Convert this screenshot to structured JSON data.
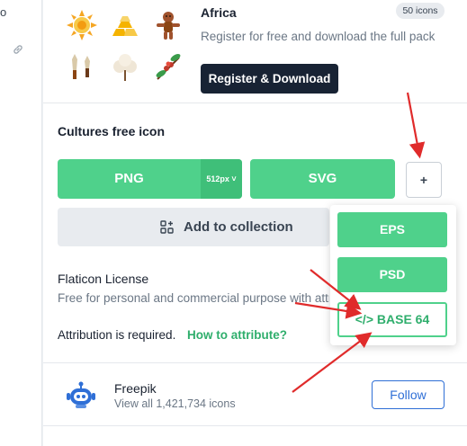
{
  "left_strip": {
    "text": "o",
    "icon": "link-icon"
  },
  "pack": {
    "title": "Africa",
    "count": "50 icons",
    "description": "Register for free and download the full pack",
    "register_label": "Register & Download",
    "icons": [
      "sun-icon",
      "gold-bars-icon",
      "voodoo-doll-icon",
      "knives-icon",
      "cotton-icon",
      "coffee-branch-icon"
    ]
  },
  "icon_title": "Cultures free icon",
  "download": {
    "png_label": "PNG",
    "png_size": "512px ˅",
    "svg_label": "SVG",
    "more_label": "+"
  },
  "collection": {
    "label": "Add to collection",
    "icon": "add-collection-icon"
  },
  "license": {
    "title": "Flaticon License",
    "description": "Free for personal and commercial purpose with attribution.",
    "attribution": "Attribution is required.",
    "attribution_link": "How to attribute?"
  },
  "formats": {
    "eps": "EPS",
    "psd": "PSD",
    "base64": "</> BASE 64"
  },
  "author": {
    "name": "Freepik",
    "icons": "View all 1,421,734 icons",
    "follow_label": "Follow",
    "avatar": "freepik-robot-icon"
  },
  "colors": {
    "green": "#4fd18b",
    "green_dark": "#3fbf79",
    "navy": "#182334",
    "link_green": "#2fae6c",
    "follow_blue": "#2f6fd6",
    "arrow_red": "#e02b2b"
  }
}
